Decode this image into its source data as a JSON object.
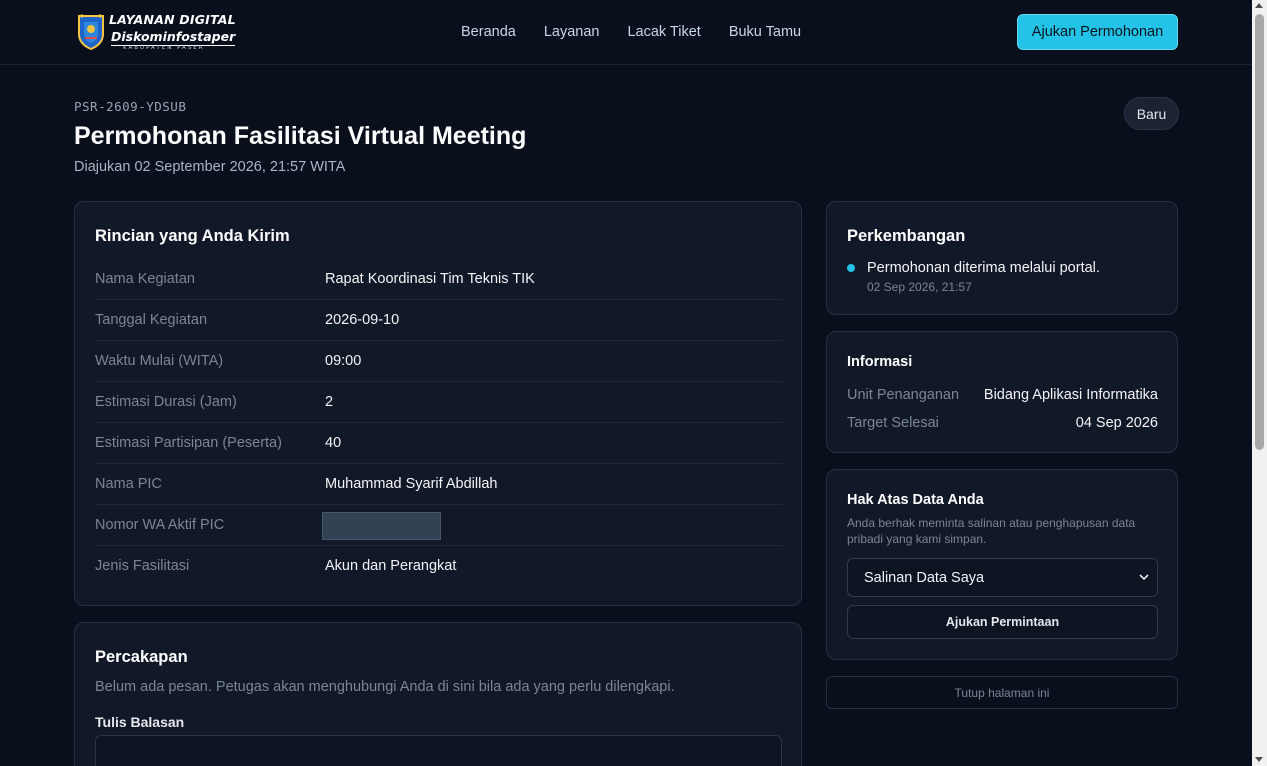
{
  "header": {
    "logo_line1": "LAYANAN DIGITAL",
    "logo_line2": "Diskominfostaper",
    "logo_line3": "KABUPATEN PASER",
    "nav": [
      "Beranda",
      "Layanan",
      "Lacak Tiket",
      "Buku Tamu"
    ],
    "cta_label": "Ajukan Permohonan"
  },
  "ticket": {
    "id": "PSR-2609-YDSUB",
    "title": "Permohonan Fasilitasi Virtual Meeting",
    "submitted": "Diajukan 02 September 2026, 21:57 WITA",
    "status": "Baru"
  },
  "details": {
    "title": "Rincian yang Anda Kirim",
    "rows": [
      {
        "label": "Nama Kegiatan",
        "value": "Rapat Koordinasi Tim Teknis TIK"
      },
      {
        "label": "Tanggal Kegiatan",
        "value": "2026-09-10"
      },
      {
        "label": "Waktu Mulai (WITA)",
        "value": "09:00"
      },
      {
        "label": "Estimasi Durasi (Jam)",
        "value": "2"
      },
      {
        "label": "Estimasi Partisipan (Peserta)",
        "value": "40"
      },
      {
        "label": "Nama PIC",
        "value": "Muhammad Syarif Abdillah"
      },
      {
        "label": "Nomor WA Aktif PIC",
        "value": ""
      },
      {
        "label": "Jenis Fasilitasi",
        "value": "Akun dan Perangkat"
      }
    ]
  },
  "conversation": {
    "title": "Percakapan",
    "empty_text": "Belum ada pesan. Petugas akan menghubungi Anda di sini bila ada yang perlu dilengkapi.",
    "reply_label": "Tulis Balasan"
  },
  "progress": {
    "title": "Perkembangan",
    "events": [
      {
        "text": "Permohonan diterima melalui portal.",
        "time": "02 Sep 2026, 21:57"
      }
    ]
  },
  "info": {
    "title": "Informasi",
    "rows": [
      {
        "label": "Unit Penanganan",
        "value": "Bidang Aplikasi Informatika"
      },
      {
        "label": "Target Selesai",
        "value": "04 Sep 2026"
      }
    ]
  },
  "rights": {
    "title": "Hak Atas Data Anda",
    "description": "Anda berhak meminta salinan atau penghapusan data pribadi yang kami simpan.",
    "selected_option": "Salinan Data Saya",
    "submit_label": "Ajukan Permintaan"
  },
  "close_label": "Tutup halaman ini",
  "colors": {
    "background": "#0a0f1c",
    "card": "#111827",
    "accent": "#22c3e6"
  }
}
